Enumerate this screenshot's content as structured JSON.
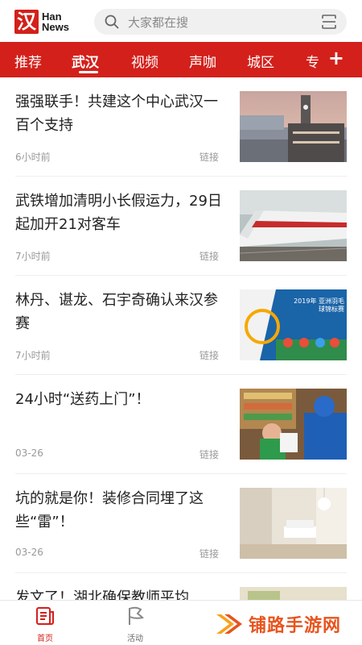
{
  "app": {
    "logo_mark": "汉",
    "logo_line1": "Han",
    "logo_line2": "News"
  },
  "search": {
    "placeholder": "大家都在搜"
  },
  "channels": [
    {
      "label": "推荐",
      "active": false
    },
    {
      "label": "武汉",
      "active": true
    },
    {
      "label": "视频",
      "active": false
    },
    {
      "label": "声咖",
      "active": false
    },
    {
      "label": "城区",
      "active": false
    },
    {
      "label": "专",
      "active": false
    }
  ],
  "channel_add": "+",
  "news": [
    {
      "title": "强强联手！共建这个中心武汉一百个支持",
      "time": "6小时前",
      "source": "链接",
      "image": "city-clock-tower-photo"
    },
    {
      "title": "武铁增加清明小长假运力，29日起加开21对客车",
      "time": "7小时前",
      "source": "链接",
      "image": "high-speed-train-photo"
    },
    {
      "title": "林丹、谌龙、石宇奇确认来汉参赛",
      "time": "7小时前",
      "source": "链接",
      "image": "badminton-poster-photo",
      "image_caption": "2019年 亚洲羽毛球锦标赛"
    },
    {
      "title": "24小时“送药上门”！",
      "time": "03-26",
      "source": "链接",
      "image": "medicine-delivery-photo"
    },
    {
      "title": "坑的就是你！装修合同埋了这些“雷”！",
      "time": "03-26",
      "source": "链接",
      "image": "living-room-photo"
    },
    {
      "title": "发文了！湖北确保教师平均",
      "time": "",
      "source": "",
      "image": "partial-photo"
    }
  ],
  "bottom_nav": [
    {
      "label": "首页",
      "icon": "news-page-icon",
      "active": true
    },
    {
      "label": "活动",
      "icon": "flag-icon",
      "active": false
    }
  ],
  "watermark": {
    "text": "铺路手游网",
    "icon": "double-arrow-logo-icon"
  },
  "colors": {
    "brand_red": "#d3201b",
    "watermark_orange": "#e8541e"
  }
}
